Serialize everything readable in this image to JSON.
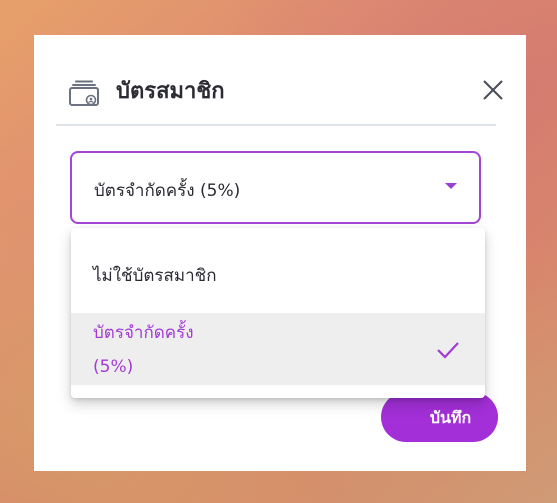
{
  "modal": {
    "title": "บัตรสมาชิก",
    "title_icon": "membership-card-icon",
    "close_icon": "close-icon"
  },
  "select": {
    "value": "บัตรจำกัดครั้ง (5%)",
    "caret_icon": "caret-down-icon"
  },
  "dropdown": {
    "options": [
      {
        "label": "ไม่ใช้บัตรสมาชิก",
        "selected": false
      },
      {
        "label_line1": "บัตรจำกัดครั้ง",
        "label_line2": "(5%)",
        "selected": true,
        "icon": "check-icon"
      }
    ]
  },
  "footer": {
    "save_label": "บันทึก"
  },
  "colors": {
    "accent": "#a22fd7",
    "selected_text": "#a33bd4",
    "selected_bg": "#eeeeee",
    "divider": "#dfe3ea"
  }
}
